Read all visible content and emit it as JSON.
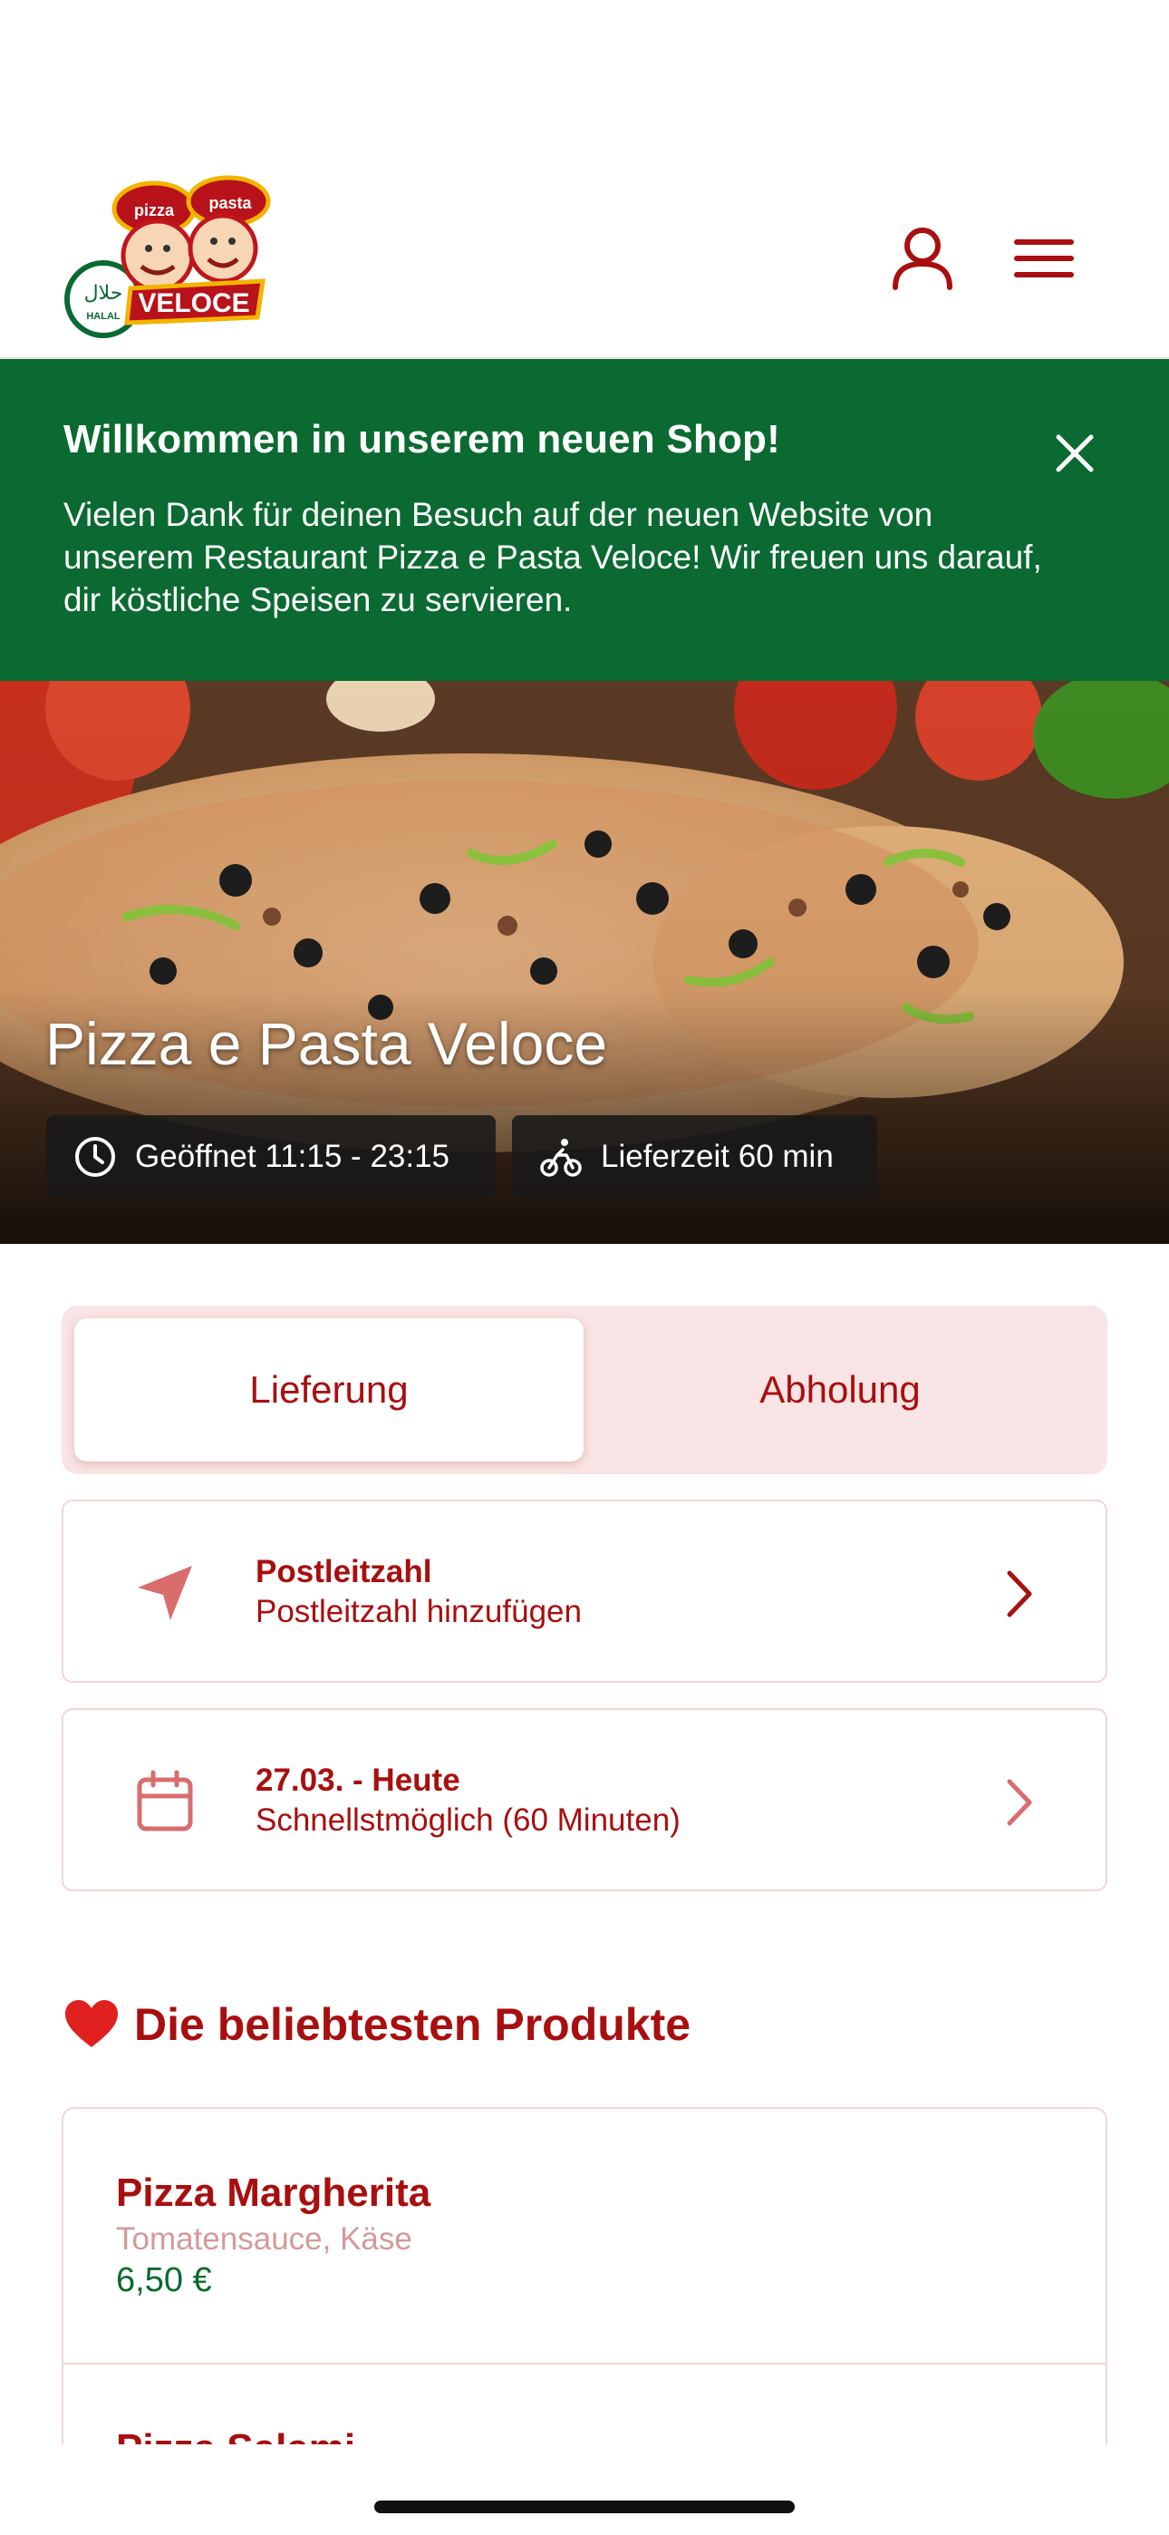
{
  "header": {
    "logo_alt": "Pizza e Pasta Veloce Halal",
    "logo_text_pizza": "pizza",
    "logo_text_pasta": "pasta",
    "logo_text_veloce": "VELOCE",
    "logo_text_halal": "HALAL",
    "user_icon": "user-icon",
    "menu_icon": "hamburger-menu-icon"
  },
  "banner": {
    "title": "Willkommen in unserem neuen Shop!",
    "text": "Vielen Dank für deinen Besuch auf der neuen Website von unserem Restaurant Pizza e Pasta Veloce! Wir freuen uns darauf, dir köstliche Speisen zu servieren.",
    "close_icon": "close-icon",
    "color": "#0a6a31"
  },
  "hero": {
    "title": "Pizza e Pasta Veloce",
    "hours_label": "Geöffnet 11:15 - 23:15",
    "delivery_label": "Lieferzeit 60 min"
  },
  "order_mode": {
    "options": [
      "Lieferung",
      "Abholung"
    ],
    "selected": "Lieferung"
  },
  "postal": {
    "title": "Postleitzahl",
    "subtitle": "Postleitzahl hinzufügen"
  },
  "schedule": {
    "title": "27.03. - Heute",
    "subtitle": "Schnellstmöglich (60 Minuten)"
  },
  "popular": {
    "title": "Die beliebtesten Produkte",
    "products": [
      {
        "name": "Pizza Margherita",
        "description": "Tomatensauce, Käse",
        "price": "6,50 €"
      },
      {
        "name": "Pizza Salami",
        "description": "",
        "price": ""
      }
    ]
  },
  "colors": {
    "brand_red": "#a80f0f",
    "brand_green": "#0a6a31",
    "soft_pink": "#f8e4e4"
  }
}
